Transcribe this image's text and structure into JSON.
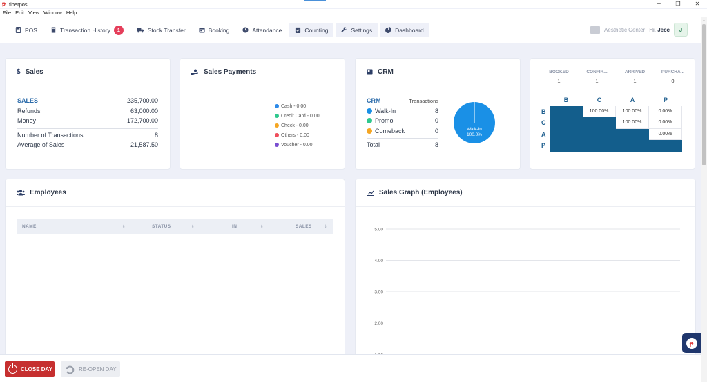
{
  "window": {
    "app_title": "fiberpos"
  },
  "menu": [
    "File",
    "Edit",
    "View",
    "Window",
    "Help"
  ],
  "nav": {
    "pos": "POS",
    "transaction_history": "Transaction History",
    "transaction_badge": "1",
    "stock_transfer": "Stock Transfer",
    "booking": "Booking",
    "attendance": "Attendance",
    "counting": "Counting",
    "settings": "Settings",
    "dashboard": "Dashboard",
    "store_name": "Aesthetic Center",
    "greeting": "Hi,",
    "user_name": "Jecc",
    "avatar_initial": "J"
  },
  "sales": {
    "title": "Sales",
    "currency_icon": "$",
    "rows": [
      {
        "label": "SALES",
        "value": "235,700.00"
      },
      {
        "label": "Refunds",
        "value": "63,000.00"
      },
      {
        "label": "Money",
        "value": "172,700.00"
      }
    ],
    "transactions_label": "Number of Transactions",
    "transactions_value": "8",
    "average_label": "Average of Sales",
    "average_value": "21,587.50"
  },
  "payments": {
    "title": "Sales Payments",
    "legend": [
      {
        "label": "Cash - 0.00",
        "color": "#2d8ae8"
      },
      {
        "label": "Credit Card - 0.00",
        "color": "#2fc88e"
      },
      {
        "label": "Check - 0.00",
        "color": "#f5a623"
      },
      {
        "label": "Others - 0.00",
        "color": "#ef4e5c"
      },
      {
        "label": "Voucher - 0.00",
        "color": "#7a4fd0"
      }
    ]
  },
  "crm": {
    "title": "CRM",
    "col_label": "CRM",
    "col_value": "Transactions",
    "rows": [
      {
        "label": "Walk-In",
        "value": "8",
        "color": "#1a90e6"
      },
      {
        "label": "Promo",
        "value": "0",
        "color": "#2fc88e"
      },
      {
        "label": "Comeback",
        "value": "0",
        "color": "#f5a623"
      }
    ],
    "total_label": "Total",
    "total_value": "8",
    "pie_label": "Walk-In",
    "pie_percent": "100.0%",
    "pie_color": "#1a90e6"
  },
  "funnel": {
    "headers": [
      {
        "label": "BOOKED",
        "value": "1"
      },
      {
        "label": "CONFIR...",
        "value": "1"
      },
      {
        "label": "ARRIVED",
        "value": "1"
      },
      {
        "label": "PURCHA...",
        "value": "0"
      }
    ],
    "columns": [
      "B",
      "C",
      "A",
      "P"
    ],
    "rows": [
      {
        "label": "B",
        "cells": [
          "",
          "100.00%",
          "100.00%",
          "0.00%"
        ]
      },
      {
        "label": "C",
        "cells": [
          "",
          "",
          "100.00%",
          "0.00%"
        ]
      },
      {
        "label": "A",
        "cells": [
          "",
          "",
          "",
          "0.00%"
        ]
      },
      {
        "label": "P",
        "cells": [
          "",
          "",
          "",
          ""
        ]
      }
    ],
    "fill_color": "#135e8c"
  },
  "employees": {
    "title": "Employees",
    "columns": [
      "NAME",
      "STATUS",
      "IN",
      "SALES"
    ]
  },
  "sales_graph": {
    "title": "Sales Graph (Employees)"
  },
  "chart_data": {
    "type": "line",
    "title": "Sales Graph (Employees)",
    "y_ticks": [
      "5.00",
      "4.00",
      "3.00",
      "2.00",
      "1.00"
    ],
    "ylim": [
      1,
      5
    ],
    "series": []
  },
  "footer": {
    "close_day": "CLOSE DAY",
    "reopen_day": "RE-OPEN DAY"
  }
}
